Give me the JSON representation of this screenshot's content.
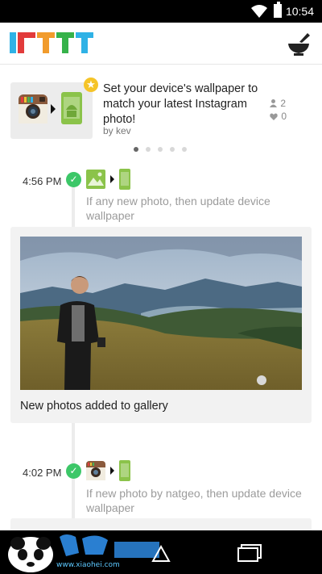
{
  "status_bar": {
    "time": "10:54"
  },
  "app_bar": {
    "logo_icon": "ifttt-logo",
    "recipes_icon": "mortar-pestle-icon"
  },
  "recommendation": {
    "title": "Set your device's wallpaper to match your latest Instagram photo!",
    "author": "by kev",
    "users_count": "2",
    "likes_count": "0",
    "pager_pages": 5,
    "pager_active": 0,
    "colors": {
      "star": "#f5c428",
      "android_green": "#8bc34a"
    }
  },
  "events": [
    {
      "time": "4:56 PM",
      "description": "If any new photo, then update device wallpaper",
      "trigger_icon": "android-photos-icon",
      "action_icon": "android-device-icon",
      "card_caption": "New photos added to gallery"
    },
    {
      "time": "4:02 PM",
      "description": "If new photo by natgeo, then update device wallpaper",
      "trigger_icon": "instagram-icon",
      "action_icon": "android-device-icon"
    }
  ],
  "colors": {
    "success_check": "#3cc768"
  },
  "watermark": {
    "url_text": "www.xiaohei.com"
  }
}
